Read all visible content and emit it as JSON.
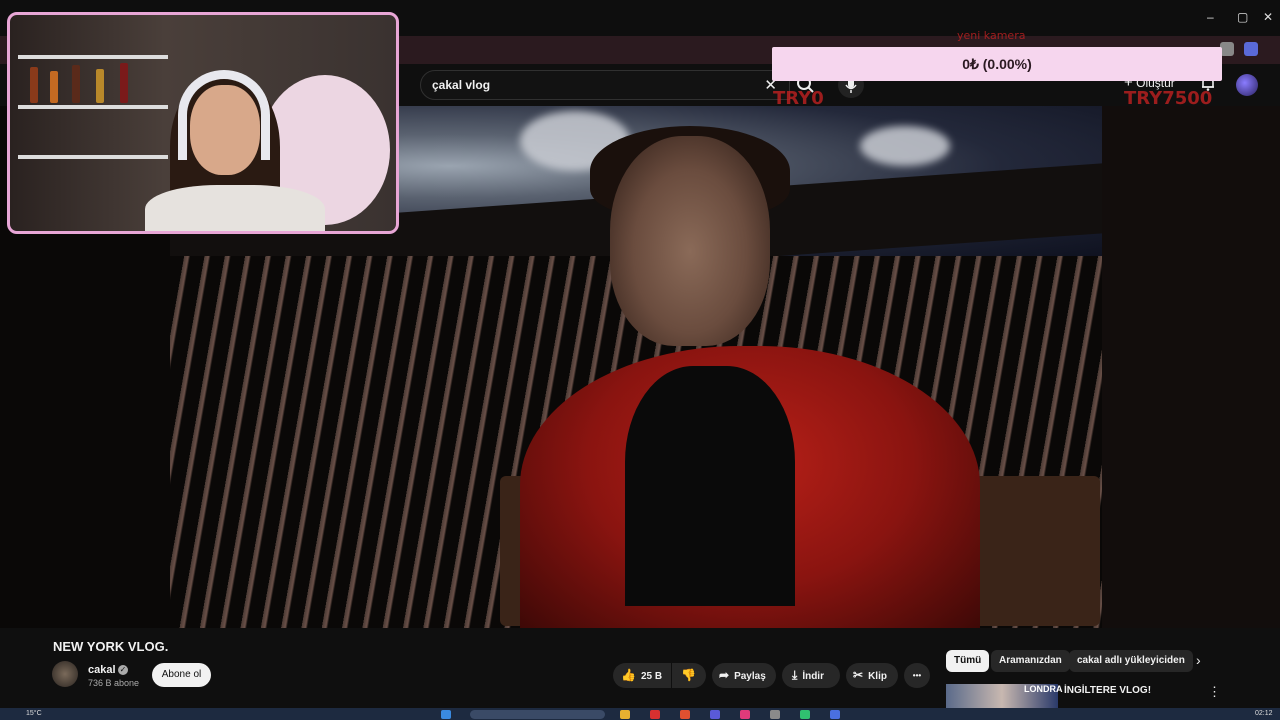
{
  "window": {
    "minimize": "–",
    "maximize": "▢",
    "close": "✕"
  },
  "search": {
    "query": "çakal vlog",
    "clear": "✕"
  },
  "header": {
    "create_label": "Oluştur"
  },
  "overlay": {
    "donation_text": "0₺ (0.00%)",
    "tag_left": "TRY0",
    "tag_right": "TRY7500",
    "tag_top": "yeni kamera"
  },
  "video": {
    "title": "NEW YORK VLOG.",
    "channel_name": "cakal",
    "subscribers": "736 B abone",
    "subscribe_label": "Abone ol",
    "likes": "25 B",
    "share_label": "Paylaş",
    "download_label": "İndir",
    "clip_label": "Klip",
    "more_label": "•••"
  },
  "chips": {
    "all": "Tümü",
    "from_search": "Aramanızdan",
    "uploader": "cakal adlı yükleyiciden"
  },
  "recommendation": {
    "title": "İNGİLTERE VLOG!",
    "thumb_text": "LONDRA"
  },
  "taskbar": {
    "temperature": "15°C",
    "time": "02:12"
  }
}
